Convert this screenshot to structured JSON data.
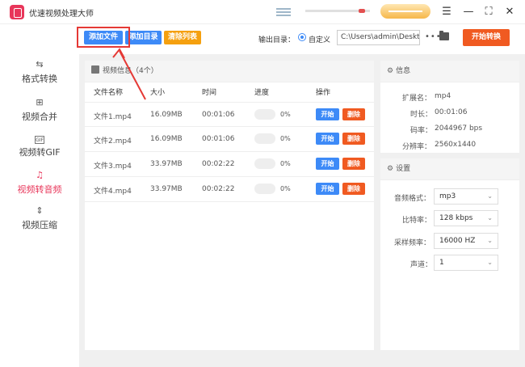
{
  "app": {
    "title": "优速视频处理大师"
  },
  "window_controls": {
    "menu": "☰",
    "minimize": "—",
    "maximize": "⛶",
    "close": "✕"
  },
  "sidebar": {
    "items": [
      {
        "label": "格式转换",
        "icon": "⇆",
        "active": false
      },
      {
        "label": "视频合并",
        "icon": "⊞",
        "active": false
      },
      {
        "label": "视频转GIF",
        "icon": "GIF",
        "active": false
      },
      {
        "label": "视频转音频",
        "icon": "♫",
        "active": true
      },
      {
        "label": "视频压缩",
        "icon": "⇕",
        "active": false
      }
    ]
  },
  "toolbar": {
    "add_file": "添加文件",
    "add_dir": "添加目录",
    "clear_list": "清除列表",
    "output_label": "输出目录：",
    "custom_label": "自定义",
    "output_path": "C:\\Users\\admin\\Deskto",
    "more": "•••",
    "start_convert": "开始转换"
  },
  "file_panel": {
    "title": "视频信息（4个）",
    "columns": [
      "文件名称",
      "大小",
      "时间",
      "进度",
      "操作"
    ],
    "rows": [
      {
        "name": "文件1.mp4",
        "size": "16.09MB",
        "time": "00:01:06",
        "progress": "0%",
        "start": "开始",
        "delete": "删除"
      },
      {
        "name": "文件2.mp4",
        "size": "16.09MB",
        "time": "00:01:06",
        "progress": "0%",
        "start": "开始",
        "delete": "删除"
      },
      {
        "name": "文件3.mp4",
        "size": "33.97MB",
        "time": "00:02:22",
        "progress": "0%",
        "start": "开始",
        "delete": "删除"
      },
      {
        "name": "文件4.mp4",
        "size": "33.97MB",
        "time": "00:02:22",
        "progress": "0%",
        "start": "开始",
        "delete": "删除"
      }
    ]
  },
  "info_panel": {
    "title": "信息",
    "items": [
      {
        "label": "扩展名：",
        "value": "mp4"
      },
      {
        "label": "时长：",
        "value": "00:01:06"
      },
      {
        "label": "码率：",
        "value": "2044967 bps"
      },
      {
        "label": "分辨率：",
        "value": "2560x1440"
      }
    ]
  },
  "settings_panel": {
    "title": "设置",
    "items": [
      {
        "label": "音频格式：",
        "value": "mp3"
      },
      {
        "label": "比特率：",
        "value": "128 kbps"
      },
      {
        "label": "采样频率：",
        "value": "16000 HZ"
      },
      {
        "label": "声道：",
        "value": "1"
      }
    ]
  },
  "colors": {
    "accent": "#e8365a",
    "blue": "#3d8af7",
    "orange": "#f5a00f",
    "red": "#f05a21",
    "highlight": "#e53935"
  }
}
